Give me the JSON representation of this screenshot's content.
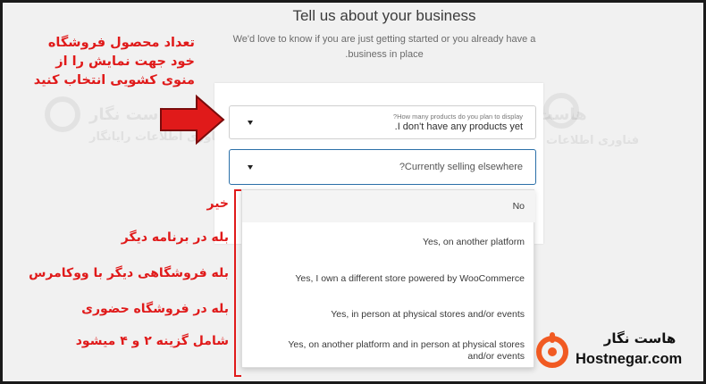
{
  "header": {
    "title": "Tell us about your business",
    "subtitle_line1": "We'd love to know if you are just getting started or you already have a",
    "subtitle_line2": ".business in place"
  },
  "form": {
    "products_select": {
      "label": "?How many products do you plan to display",
      "value": ".I don't have any products yet"
    },
    "selling_select": {
      "placeholder": "?Currently selling elsewhere"
    },
    "dropdown_options": [
      "No",
      "Yes, on another platform",
      "Yes, I own a different store powered by WooCommerce",
      "Yes, in person at physical stores and/or events",
      "Yes, on another platform and in person at physical stores",
      "and/or events"
    ]
  },
  "annotations": {
    "top_note_line1": "تعداد محصول فروشگاه",
    "top_note_line2": "خود جهت نمایش را از",
    "top_note_line3": "منوی کشویی انتخاب کنید",
    "option_notes": [
      "خیر",
      "بله در برنامه دیگر",
      "بله فروشگاهی دیگر با ووکامرس",
      "بله در فروشگاه حضوری",
      "شامل گزینه ۲ و ۴ میشود"
    ]
  },
  "watermark": {
    "name_fa": "هاست نگار",
    "tagline_fa": "فناوری اطلاعات رایانگار"
  },
  "logo": {
    "name_fa": "هاست نگار",
    "name_en": "Hostnegar.com"
  },
  "colors": {
    "annotation_red": "#e01a1a",
    "logo_orange": "#f15a22",
    "focus_border": "#2a6fa8"
  },
  "icons": {
    "arrow": "red-arrow-icon",
    "caret": "caret-down-icon",
    "logo": "hostnegar-logo-icon"
  }
}
